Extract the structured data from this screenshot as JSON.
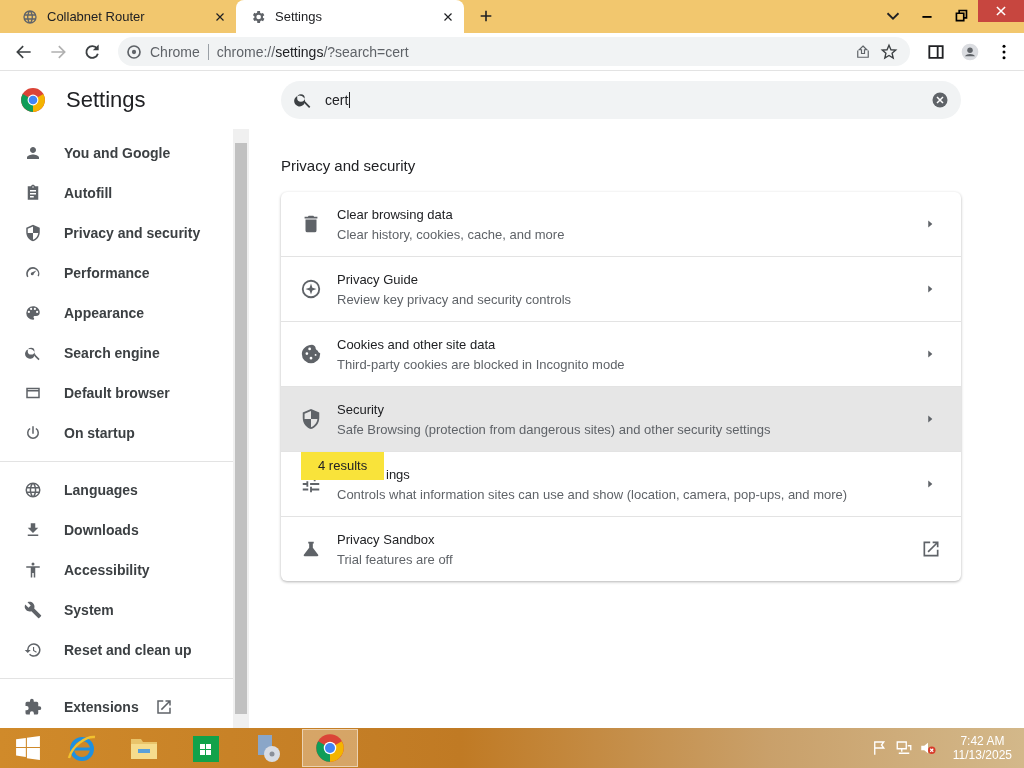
{
  "tabs": [
    {
      "title": "Collabnet Router",
      "selected": false
    },
    {
      "title": "Settings",
      "selected": true
    }
  ],
  "toolbar": {
    "site_label": "Chrome",
    "url_prefix": "chrome://",
    "url_host": "settings",
    "url_rest": "/?search=cert"
  },
  "page": {
    "title": "Settings",
    "search": {
      "value": "cert"
    }
  },
  "sidebar": {
    "groups": [
      [
        {
          "label": "You and Google",
          "kind": "page"
        },
        {
          "label": "Autofill",
          "kind": "page"
        },
        {
          "label": "Privacy and security",
          "kind": "page"
        },
        {
          "label": "Performance",
          "kind": "page"
        },
        {
          "label": "Appearance",
          "kind": "page"
        },
        {
          "label": "Search engine",
          "kind": "page"
        },
        {
          "label": "Default browser",
          "kind": "page"
        },
        {
          "label": "On startup",
          "kind": "page"
        }
      ],
      [
        {
          "label": "Languages",
          "kind": "page"
        },
        {
          "label": "Downloads",
          "kind": "page"
        },
        {
          "label": "Accessibility",
          "kind": "page"
        },
        {
          "label": "System",
          "kind": "page"
        },
        {
          "label": "Reset and clean up",
          "kind": "page"
        }
      ],
      [
        {
          "label": "Extensions",
          "kind": "external"
        }
      ]
    ]
  },
  "section": {
    "title": "Privacy and security",
    "rows": [
      {
        "title": "Clear browsing data",
        "subtitle": "Clear history, cookies, cache, and more",
        "kind": "subpage",
        "hovered": false
      },
      {
        "title": "Privacy Guide",
        "subtitle": "Review key privacy and security controls",
        "kind": "subpage",
        "hovered": false
      },
      {
        "title": "Cookies and other site data",
        "subtitle": "Third-party cookies are blocked in Incognito mode",
        "kind": "subpage",
        "hovered": false
      },
      {
        "title": "Security",
        "subtitle": "Safe Browsing (protection from dangerous sites) and other security settings",
        "kind": "subpage",
        "hovered": true
      },
      {
        "title": "ings",
        "subtitle": "Controls what information sites can use and show (location, camera, pop-ups, and more)",
        "kind": "subpage",
        "hovered": false,
        "tooltip": "4 results"
      },
      {
        "title": "Privacy Sandbox",
        "subtitle": "Trial features are off",
        "kind": "external",
        "hovered": false
      }
    ]
  },
  "taskbar": {
    "apps": [
      {
        "selected": false
      },
      {
        "selected": false
      },
      {
        "selected": false
      },
      {
        "selected": false
      },
      {
        "selected": true
      }
    ],
    "time": "7:42 AM",
    "date": "11/13/2025"
  }
}
